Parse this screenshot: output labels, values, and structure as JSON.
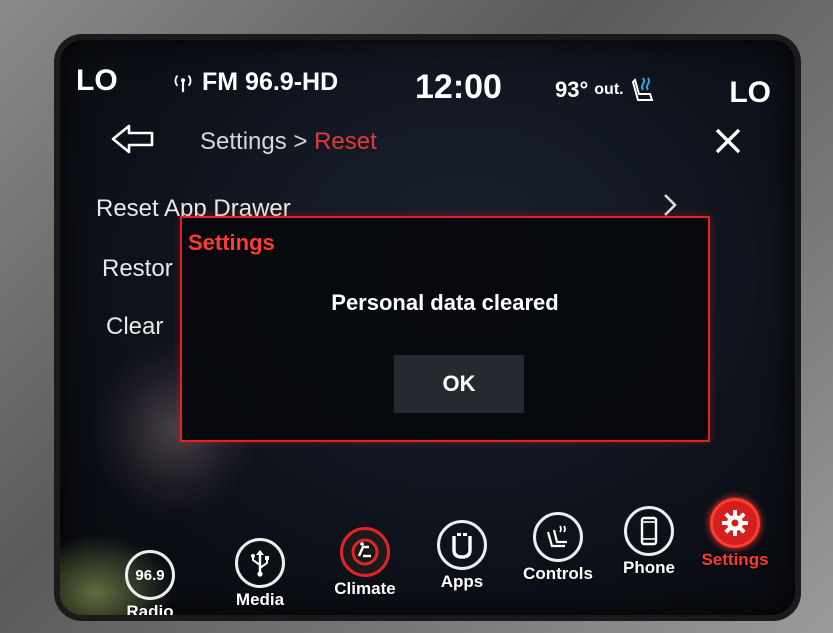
{
  "status_bar": {
    "left_temp_setting": "LO",
    "right_temp_setting": "LO",
    "radio": "FM 96.9-HD",
    "clock": "12:00",
    "outside_temp": "93°",
    "outside_unit": "out."
  },
  "header": {
    "breadcrumb_parent": "Settings >",
    "breadcrumb_current": "Reset"
  },
  "menu": {
    "items": [
      {
        "label": "Reset App Drawer"
      },
      {
        "label": "Restor"
      },
      {
        "label": "Clear"
      }
    ]
  },
  "dialog": {
    "title": "Settings",
    "message": "Personal data cleared",
    "ok_label": "OK"
  },
  "nav": {
    "items": [
      {
        "label": "Radio",
        "icon": "radio-icon",
        "icon_text": "96.9"
      },
      {
        "label": "Media",
        "icon": "usb-icon"
      },
      {
        "label": "Climate",
        "icon": "climate-icon"
      },
      {
        "label": "Apps",
        "icon": "apps-icon"
      },
      {
        "label": "Controls",
        "icon": "controls-icon"
      },
      {
        "label": "Phone",
        "icon": "phone-icon"
      },
      {
        "label": "Settings",
        "icon": "gear-icon",
        "active": true
      }
    ]
  },
  "colors": {
    "accent_red": "#e52222",
    "text": "#ffffff",
    "background": "#0d1119"
  }
}
